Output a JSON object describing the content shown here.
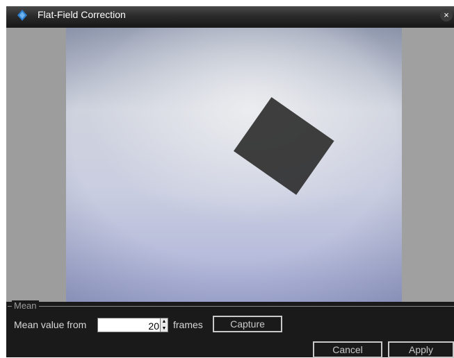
{
  "window": {
    "title": "Flat-Field Correction",
    "close_glyph": "×"
  },
  "mean_group": {
    "label": "Mean",
    "mean_value_label": "Mean value from",
    "frames_value": "20",
    "frames_label": "frames",
    "capture_label": "Capture"
  },
  "footer": {
    "cancel_label": "Cancel",
    "apply_label": "Apply"
  },
  "icons": {
    "app": "app-logo-icon",
    "close": "close-icon",
    "spin_up": "spinner-up-icon",
    "spin_down": "spinner-down-icon"
  },
  "colors": {
    "window_bg": "#1a1a1a",
    "button_border": "#c9c9c9",
    "watermark": "#2b2b2b"
  }
}
